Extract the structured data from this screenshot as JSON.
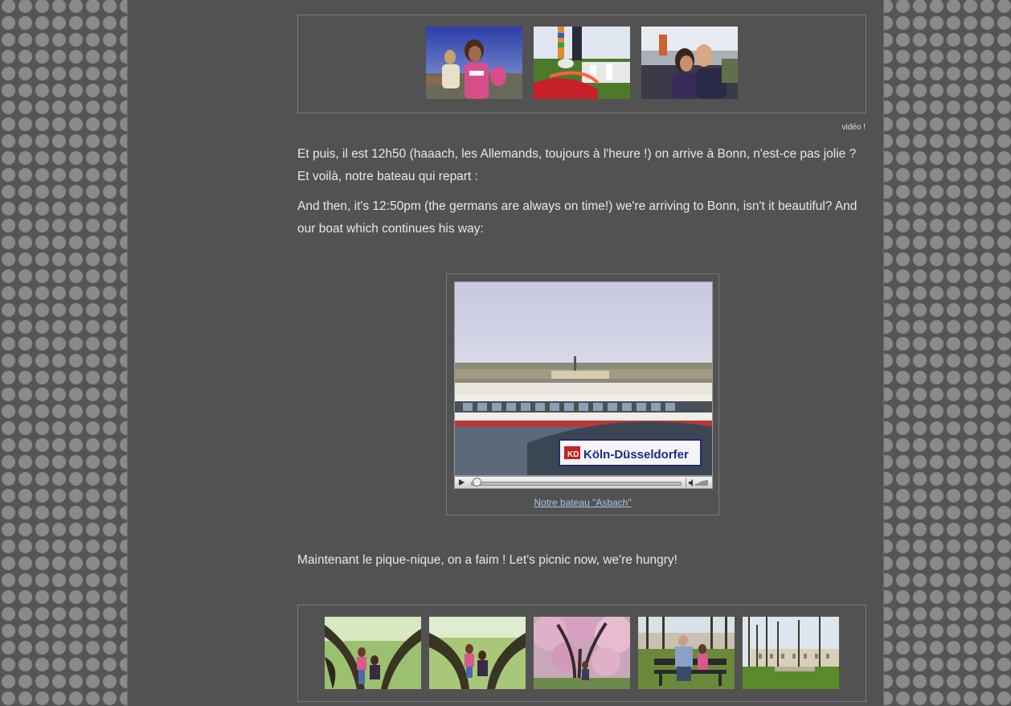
{
  "gallery_top": {
    "thumbnails": [
      "photo-girls-on-boat",
      "photo-legs-on-slide",
      "photo-couple-kiss"
    ]
  },
  "video_link": "vidéo !",
  "paragraph_fr_1": "Et puis, il est 12h50 (haaach, les Allemands, toujours à l'heure !) on arrive à Bonn, n'est-ce pas jolie ? Et voilà, notre bateau qui repart :",
  "paragraph_en_1": "And then, it's 12:50pm (the germans are always on time!) we're arriving to Bonn, isn't it beautiful? And our boat which continues his way:",
  "video": {
    "frame_sign": "Köln-Düsseldorfer",
    "frame_logo": "KD",
    "caption": "Notre bateau \"Asbach\"",
    "progress": 0.0
  },
  "paragraph_picnic": "Maintenant le pique-nique, on a faim ! Let's picnic now, we're hungry!",
  "gallery_bottom": {
    "thumbnails": [
      "photo-tree-climbing-1",
      "photo-tree-climbing-2",
      "photo-cherry-blossom",
      "photo-park-bench",
      "photo-park-avenue"
    ]
  }
}
